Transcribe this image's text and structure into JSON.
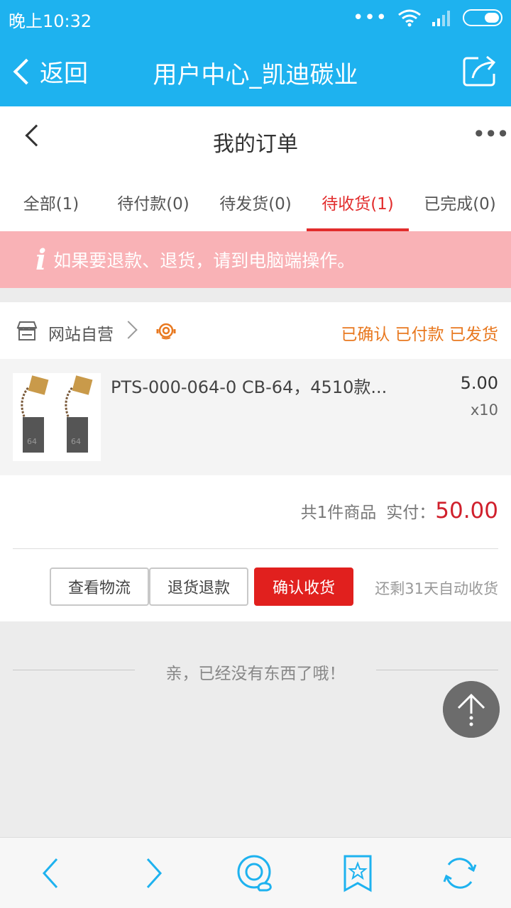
{
  "status_bar": {
    "time": "晚上10:32",
    "dots": "•••"
  },
  "browser_nav": {
    "back_label": "返回",
    "title": "用户中心_凯迪碳业"
  },
  "page": {
    "title": "我的订单",
    "more": "•••"
  },
  "tabs": [
    {
      "label": "全部(1)",
      "active": false
    },
    {
      "label": "待付款(0)",
      "active": false
    },
    {
      "label": "待发货(0)",
      "active": false
    },
    {
      "label": "待收货(1)",
      "active": true
    },
    {
      "label": "已完成(0)",
      "active": false
    }
  ],
  "notice": {
    "icon": "i",
    "text": "如果要退款、退货，请到电脑端操作。"
  },
  "order": {
    "shop_name": "网站自营",
    "status": "已确认 已付款 已发货",
    "product": {
      "name": "PTS-000-064-0 CB-64，4510款...",
      "price": "5.00",
      "qty": "x10"
    },
    "summary": {
      "count": "共1件商品",
      "label": "实付：",
      "amount": "50.00"
    },
    "buttons": {
      "logistics": "查看物流",
      "refund": "退货退款",
      "confirm": "确认收货"
    },
    "auto_receive": "还剩31天自动收货"
  },
  "end_text": "亲，已经没有东西了哦！",
  "colors": {
    "header": "#1eb2ef",
    "accent_red": "#e22c2c",
    "status_orange": "#e8781f",
    "notice_bg": "#f9b2b6",
    "icon_blue": "#1eb2ef"
  }
}
